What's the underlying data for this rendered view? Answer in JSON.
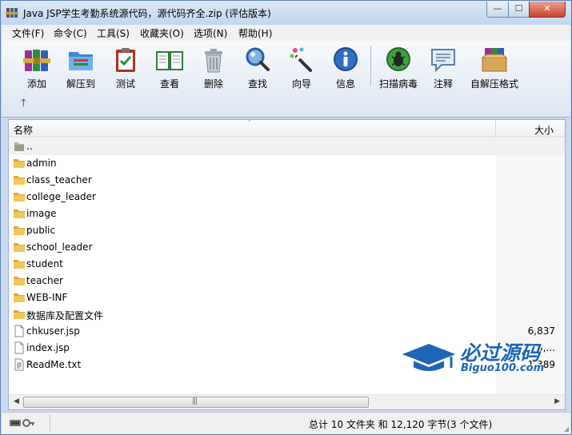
{
  "window": {
    "title": "Java JSP学生考勤系统源代码，源代码齐全.zip (评估版本)",
    "controls": {
      "minimize": "—",
      "maximize": "☐",
      "close": "✕"
    }
  },
  "menu": [
    "文件(F)",
    "命令(C)",
    "工具(S)",
    "收藏夹(O)",
    "选项(N)",
    "帮助(H)"
  ],
  "toolbar": {
    "buttons": [
      {
        "label": "添加",
        "icon": "add-books-icon"
      },
      {
        "label": "解压到",
        "icon": "extract-folder-icon"
      },
      {
        "label": "测试",
        "icon": "test-clipboard-icon"
      },
      {
        "label": "查看",
        "icon": "view-book-icon"
      },
      {
        "label": "删除",
        "icon": "delete-trash-icon"
      },
      {
        "label": "查找",
        "icon": "find-magnifier-icon"
      },
      {
        "label": "向导",
        "icon": "wizard-wand-icon"
      },
      {
        "label": "信息",
        "icon": "info-icon"
      },
      {
        "label": "扫描病毒",
        "icon": "virus-scan-icon"
      },
      {
        "label": "注释",
        "icon": "comment-icon"
      },
      {
        "label": "自解压格式",
        "icon": "sfx-box-icon"
      }
    ],
    "up_arrow": "↑"
  },
  "filelist": {
    "columns": {
      "name": "名称",
      "size": "大小"
    },
    "sort_indicator": "˄",
    "rows": [
      {
        "name": "..",
        "type": "parent",
        "size": ""
      },
      {
        "name": "admin",
        "type": "folder",
        "size": ""
      },
      {
        "name": "class_teacher",
        "type": "folder",
        "size": ""
      },
      {
        "name": "college_leader",
        "type": "folder",
        "size": ""
      },
      {
        "name": "image",
        "type": "folder",
        "size": ""
      },
      {
        "name": "public",
        "type": "folder",
        "size": ""
      },
      {
        "name": "school_leader",
        "type": "folder",
        "size": ""
      },
      {
        "name": "student",
        "type": "folder",
        "size": ""
      },
      {
        "name": "teacher",
        "type": "folder",
        "size": ""
      },
      {
        "name": "WEB-INF",
        "type": "folder",
        "size": ""
      },
      {
        "name": "数据库及配置文件",
        "type": "folder",
        "size": ""
      },
      {
        "name": "chkuser.jsp",
        "type": "file",
        "size": "6,837"
      },
      {
        "name": "index.jsp",
        "type": "file",
        "size": "3,..."
      },
      {
        "name": "ReadMe.txt",
        "type": "text",
        "size": "1,389"
      }
    ]
  },
  "hscroll": {
    "left": "◀",
    "right": "▶",
    "grip": "|||"
  },
  "status": {
    "summary": "总计 10 文件夹 和 12,120 字节(3 个文件)"
  },
  "watermark": {
    "brand": "必过源码",
    "url": "Biguo100.com"
  },
  "colors": {
    "accent": "#1c66b5",
    "folder": "#e8b84a"
  }
}
